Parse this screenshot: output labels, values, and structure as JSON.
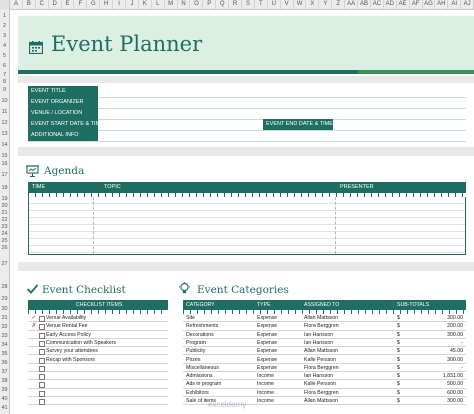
{
  "columns": [
    "A",
    "B",
    "C",
    "D",
    "E",
    "F",
    "G",
    "H",
    "I",
    "J",
    "K",
    "L",
    "M",
    "N",
    "O",
    "P",
    "Q",
    "R",
    "S",
    "T",
    "U",
    "V",
    "W",
    "X",
    "Y",
    "Z",
    "AA",
    "AB",
    "AC",
    "AD",
    "AE",
    "AF",
    "AG",
    "AH",
    "AI",
    "AJ"
  ],
  "rows": {
    "r1": "1",
    "r2": "2",
    "r3": "3",
    "r4": "4",
    "r5": "5",
    "r6": "6",
    "r7": "7",
    "r8": "8",
    "r9": "9",
    "r10": "10",
    "r11": "11",
    "r12": "12",
    "r13": "13",
    "r14": "14",
    "r15": "15",
    "r16": "16",
    "r17": "17",
    "r18": "18",
    "r19": "19",
    "r20": "20",
    "r21": "21",
    "r22": "22",
    "r23": "23",
    "r24": "24",
    "r25": "25",
    "r26": "26",
    "r27": "27",
    "r28": "28",
    "r29": "29",
    "r30": "30",
    "r31": "31",
    "r32": "32",
    "r33": "33",
    "r34": "34",
    "r35": "35",
    "r36": "36",
    "r37": "37",
    "r38": "38",
    "r39": "39",
    "r40": "40",
    "r41": "41"
  },
  "title": "Event Planner",
  "info": {
    "event_title": "EVENT TITLE",
    "event_organizer": "EVENT ORGANIZER",
    "venue": "VENUE / LOCATION",
    "start": "EVENT START DATE & TIME",
    "end": "EVENT END DATE & TIME",
    "additional": "ADDITIONAL INFO"
  },
  "agenda": {
    "title": "Agenda",
    "headers": {
      "time": "TIME",
      "topic": "TOPIC",
      "presenter": "PRESENTER"
    }
  },
  "checklist": {
    "title": "Event Checklist",
    "header": "CHECKLIST ITEMS",
    "items": [
      {
        "mark": "✓",
        "text": "Venue Availability"
      },
      {
        "mark": "✗",
        "text": "Venue Rental Fee"
      },
      {
        "mark": "",
        "text": "Early Access Policy"
      },
      {
        "mark": "",
        "text": "Communication with Speakers"
      },
      {
        "mark": "",
        "text": "Survey your attendees"
      },
      {
        "mark": "",
        "text": "Recap with Sponsors"
      },
      {
        "mark": "",
        "text": ""
      },
      {
        "mark": "",
        "text": ""
      },
      {
        "mark": "",
        "text": ""
      },
      {
        "mark": "",
        "text": ""
      },
      {
        "mark": "",
        "text": ""
      }
    ]
  },
  "categories": {
    "title": "Event Categories",
    "headers": {
      "category": "CATEGORY",
      "type": "TYPE",
      "assigned": "ASSIGNED TO",
      "subtotals": "SUB-TOTALS"
    },
    "rows": [
      {
        "category": "Site",
        "type": "Expense",
        "assigned": "Allan Mattsson",
        "currency": "$",
        "amount": "300.00"
      },
      {
        "category": "Refreshments",
        "type": "Expense",
        "assigned": "Flora Berggren",
        "currency": "$",
        "amount": "200.00"
      },
      {
        "category": "Decorations",
        "type": "Expense",
        "assigned": "Ian Hansson",
        "currency": "$",
        "amount": "300.00"
      },
      {
        "category": "Program",
        "type": "Expense",
        "assigned": "Ian Hansson",
        "currency": "$",
        "amount": "-"
      },
      {
        "category": "Publicity",
        "type": "Expense",
        "assigned": "Allan Mattsson",
        "currency": "$",
        "amount": "45.00"
      },
      {
        "category": "Prizes",
        "type": "Expense",
        "assigned": "Kalle Persson",
        "currency": "$",
        "amount": "300.00"
      },
      {
        "category": "Miscellaneous",
        "type": "Expense",
        "assigned": "Flora Berggren",
        "currency": "$",
        "amount": "-"
      },
      {
        "category": "Admissions",
        "type": "Income",
        "assigned": "Ian Hansson",
        "currency": "$",
        "amount": "1,831.00"
      },
      {
        "category": "Ads in program",
        "type": "Income",
        "assigned": "Kalle Persson",
        "currency": "$",
        "amount": "500.00"
      },
      {
        "category": "Exhibitors",
        "type": "Income",
        "assigned": "Flora Berggren",
        "currency": "$",
        "amount": "600.00"
      },
      {
        "category": "Sale of items",
        "type": "Income",
        "assigned": "Allan Mattsson",
        "currency": "$",
        "amount": "300.00"
      }
    ]
  },
  "watermark": "exceldemy",
  "colors": {
    "primary": "#1f6e62",
    "banner_bg": "#dcefe3",
    "accent": "#3c8f55",
    "check": "#1f6e62",
    "cross": "#d9342b"
  },
  "icons": {
    "title": "calendar-icon",
    "agenda": "presentation-board-icon",
    "checklist": "checkmark-icon",
    "categories": "lightbulb-icon"
  }
}
